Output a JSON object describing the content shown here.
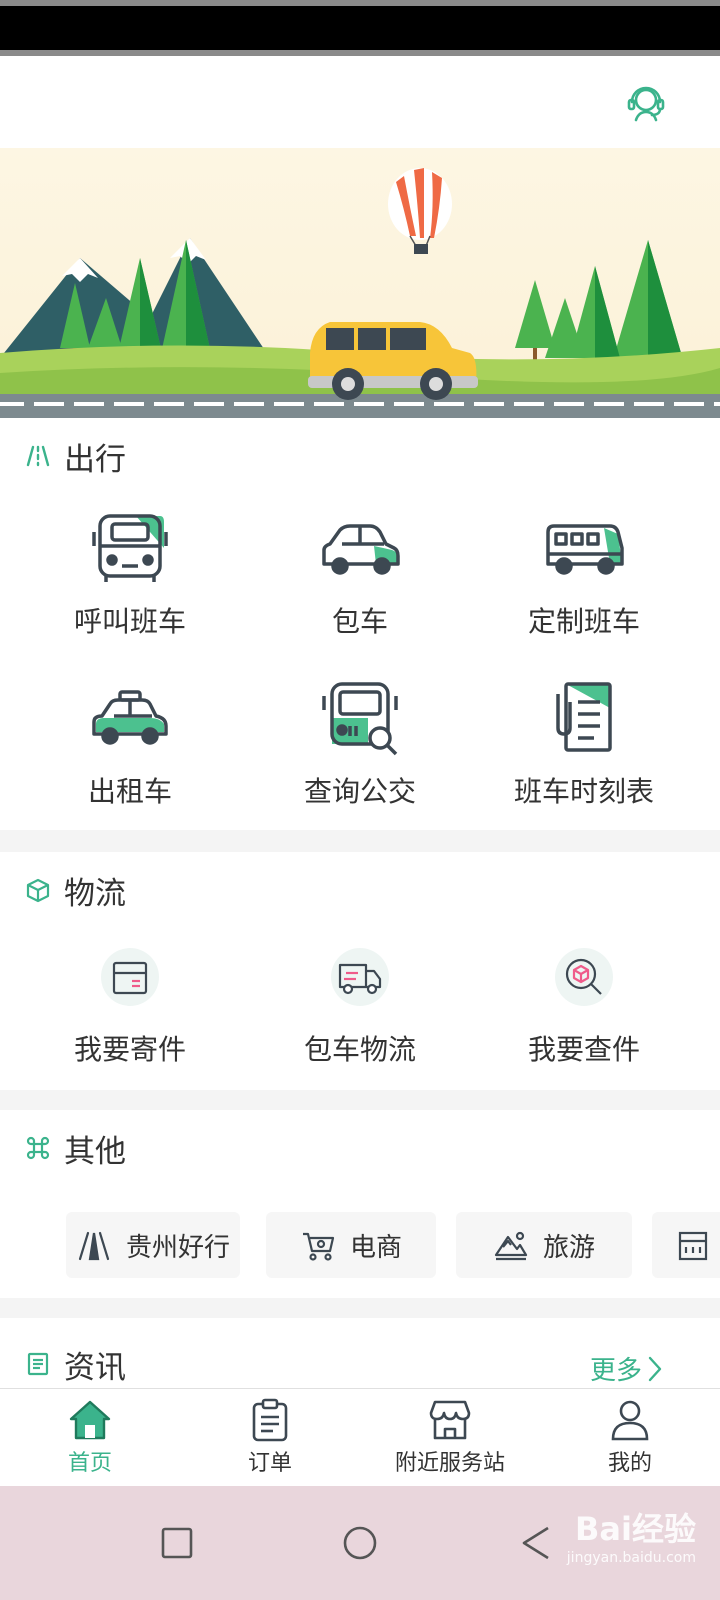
{
  "colors": {
    "accent": "#3bb38c",
    "text": "#333333",
    "icon_dark": "#3d4852"
  },
  "header": {
    "service_icon": "headset-icon"
  },
  "sections": {
    "travel": {
      "title": "出行",
      "items": [
        {
          "label": "呼叫班车",
          "icon": "bus-icon"
        },
        {
          "label": "包车",
          "icon": "car-icon"
        },
        {
          "label": "定制班车",
          "icon": "coach-icon"
        },
        {
          "label": "出租车",
          "icon": "taxi-icon"
        },
        {
          "label": "查询公交",
          "icon": "bus-search-icon"
        },
        {
          "label": "班车时刻表",
          "icon": "timetable-icon"
        }
      ]
    },
    "logistics": {
      "title": "物流",
      "items": [
        {
          "label": "我要寄件",
          "icon": "parcel-icon"
        },
        {
          "label": "包车物流",
          "icon": "truck-icon"
        },
        {
          "label": "我要查件",
          "icon": "parcel-search-icon"
        }
      ]
    },
    "other": {
      "title": "其他",
      "chips": [
        {
          "label": "贵州好行",
          "icon": "road-icon"
        },
        {
          "label": "电商",
          "icon": "cart-icon"
        },
        {
          "label": "旅游",
          "icon": "mountain-icon"
        }
      ]
    },
    "news": {
      "title": "资讯",
      "more": "更多"
    }
  },
  "tabbar": {
    "items": [
      {
        "label": "首页",
        "icon": "home-icon",
        "active": true
      },
      {
        "label": "订单",
        "icon": "clipboard-icon",
        "active": false
      },
      {
        "label": "附近服务站",
        "icon": "store-icon",
        "active": false
      },
      {
        "label": "我的",
        "icon": "user-icon",
        "active": false
      }
    ]
  },
  "watermark": {
    "main": "Bai经验",
    "sub": "jingyan.baidu.com"
  }
}
